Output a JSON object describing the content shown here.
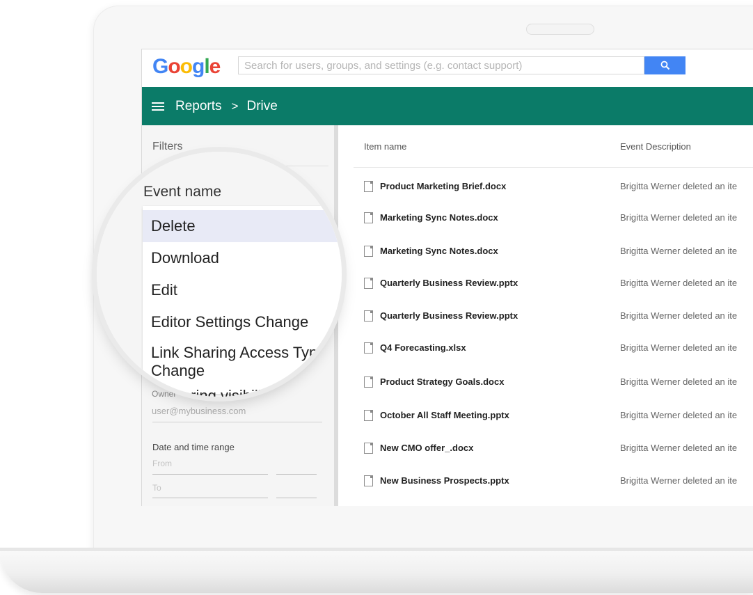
{
  "app": {
    "logo_letters": [
      "G",
      "o",
      "o",
      "g",
      "l",
      "e"
    ],
    "search": {
      "placeholder": "Search for users, groups, and settings (e.g. contact support)"
    }
  },
  "breadcrumb": {
    "root": "Reports",
    "separator": ">",
    "current": "Drive"
  },
  "filters": {
    "title": "Filters",
    "event_name": {
      "label": "Event name",
      "options": [
        "Delete",
        "Download",
        "Edit",
        "Editor Settings Change",
        "Link Sharing Access Type Change"
      ],
      "selected": "Delete",
      "next_option_partial": "Sharing visibility"
    },
    "owner": {
      "label": "Owner",
      "placeholder": "user@mybusiness.com"
    },
    "date_range": {
      "label": "Date and time range",
      "from": "From",
      "to": "To"
    }
  },
  "table": {
    "columns": [
      "Item name",
      "Event Description"
    ],
    "rows": [
      {
        "name": "Product Marketing Brief.docx",
        "desc": "Brigitta Werner deleted an ite"
      },
      {
        "name": "Marketing Sync Notes.docx",
        "desc": "Brigitta Werner deleted an ite"
      },
      {
        "name": "Marketing Sync Notes.docx",
        "desc": "Brigitta Werner deleted an ite"
      },
      {
        "name": "Quarterly Business Review.pptx",
        "desc": "Brigitta Werner deleted an ite"
      },
      {
        "name": "Quarterly Business Review.pptx",
        "desc": "Brigitta Werner deleted an ite"
      },
      {
        "name": "Q4 Forecasting.xlsx",
        "desc": "Brigitta Werner deleted an ite"
      },
      {
        "name": "Product Strategy Goals.docx",
        "desc": "Brigitta Werner deleted an ite"
      },
      {
        "name": "October All Staff Meeting.pptx",
        "desc": "Brigitta Werner deleted an ite"
      },
      {
        "name": "New CMO offer_.docx",
        "desc": "Brigitta Werner deleted an ite"
      },
      {
        "name": "New Business Prospects.pptx",
        "desc": "Brigitta Werner deleted an ite"
      }
    ]
  },
  "colors": {
    "nav_bar": "#0b7b68",
    "search_button": "#4285f4",
    "selected_option": "#e8eaf6"
  },
  "icons": [
    "search-icon",
    "menu-icon",
    "chevron-right-icon",
    "file-icon"
  ]
}
